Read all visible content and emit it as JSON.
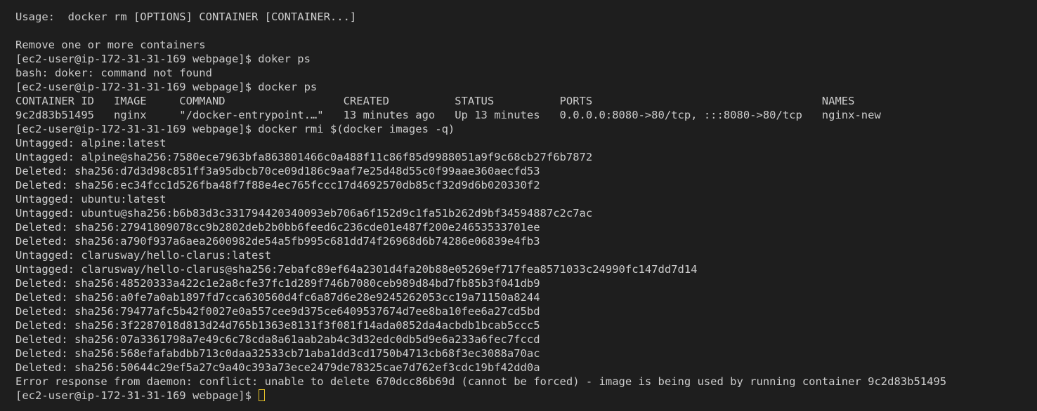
{
  "terminal": {
    "lines": [
      "Usage:  docker rm [OPTIONS] CONTAINER [CONTAINER...]",
      "",
      "Remove one or more containers",
      "[ec2-user@ip-172-31-31-169 webpage]$ doker ps",
      "bash: doker: command not found",
      "[ec2-user@ip-172-31-31-169 webpage]$ docker ps",
      "CONTAINER ID   IMAGE     COMMAND                  CREATED          STATUS          PORTS                                   NAMES",
      "9c2d83b51495   nginx     \"/docker-entrypoint.…\"   13 minutes ago   Up 13 minutes   0.0.0.0:8080->80/tcp, :::8080->80/tcp   nginx-new",
      "[ec2-user@ip-172-31-31-169 webpage]$ docker rmi $(docker images -q)",
      "Untagged: alpine:latest",
      "Untagged: alpine@sha256:7580ece7963bfa863801466c0a488f11c86f85d9988051a9f9c68cb27f6b7872",
      "Deleted: sha256:d7d3d98c851ff3a95dbcb70ce09d186c9aaf7e25d48d55c0f99aae360aecfd53",
      "Deleted: sha256:ec34fcc1d526fba48f7f88e4ec765fccc17d4692570db85cf32d9d6b020330f2",
      "Untagged: ubuntu:latest",
      "Untagged: ubuntu@sha256:b6b83d3c331794420340093eb706a6f152d9c1fa51b262d9bf34594887c2c7ac",
      "Deleted: sha256:27941809078cc9b2802deb2b0bb6feed6c236cde01e487f200e24653533701ee",
      "Deleted: sha256:a790f937a6aea2600982de54a5fb995c681dd74f26968d6b74286e06839e4fb3",
      "Untagged: clarusway/hello-clarus:latest",
      "Untagged: clarusway/hello-clarus@sha256:7ebafc89ef64a2301d4fa20b88e05269ef717fea8571033c24990fc147dd7d14",
      "Deleted: sha256:48520333a422c1e2a8cfe37fc1d289f746b7080ceb989d84bd7fb85b3f041db9",
      "Deleted: sha256:a0fe7a0ab1897fd7cca630560d4fc6a87d6e28e9245262053cc19a71150a8244",
      "Deleted: sha256:79477afc5b42f0027e0a557cee9d375ce6409537674d7ee8ba10fee6a27cd5bd",
      "Deleted: sha256:3f2287018d813d24d765b1363e8131f3f081f14ada0852da4acbdb1bcab5ccc5",
      "Deleted: sha256:07a3361798a7e49c6c78cda8a61aab2ab4c3d32edc0db5d9e6a233a6fec7fccd",
      "Deleted: sha256:568efafabdbb713c0daa32533cb71aba1dd3cd1750b4713cb68f3ec3088a70ac",
      "Deleted: sha256:50644c29ef5a27c9a40c393a73ece2479de78325cae7d762ef3cdc19bf42dd0a",
      "Error response from daemon: conflict: unable to delete 670dcc86b69d (cannot be forced) - image is being used by running container 9c2d83b51495"
    ],
    "prompt": "[ec2-user@ip-172-31-31-169 webpage]$ "
  },
  "colors": {
    "background": "#1e1e1e",
    "text": "#cccccc",
    "cursor": "#e6c229"
  }
}
